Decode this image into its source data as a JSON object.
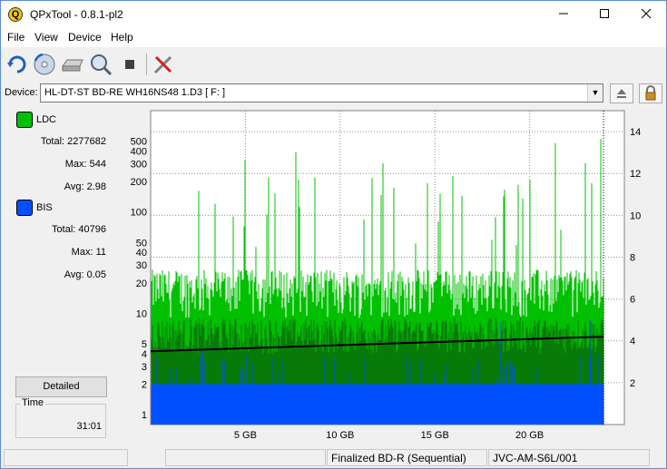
{
  "window": {
    "title": "QPxTool - 0.8.1-pl2",
    "icon_letter": "Q"
  },
  "menu": {
    "items": [
      "File",
      "View",
      "Device",
      "Help"
    ]
  },
  "toolbar": {
    "icons": [
      "refresh-icon",
      "disc-icon",
      "drive-icon",
      "zoom-icon",
      "stop-icon",
      "tools-icon"
    ]
  },
  "device": {
    "label": "Device:",
    "selected": "HL-DT-ST BD-RE  WH16NS48  1.D3 [ F: ]"
  },
  "legend": {
    "ldc": {
      "name": "LDC",
      "color": "#00c000",
      "total_label": "Total:",
      "total": "2277682",
      "max_label": "Max:",
      "max": "544",
      "avg_label": "Avg:",
      "avg": "2.98"
    },
    "bis": {
      "name": "BIS",
      "color": "#0050ff",
      "total_label": "Total:",
      "total": "40796",
      "max_label": "Max:",
      "max": "11",
      "avg_label": "Avg:",
      "avg": "0.05"
    }
  },
  "detailed_button": "Detailed",
  "time": {
    "label": "Time",
    "value": "31:01"
  },
  "status": {
    "disc_type": "Finalized BD-R (Sequential)",
    "media_id": "JVC-AM-S6L/001"
  },
  "chart_data": {
    "type": "area",
    "x_ticks": [
      "5 GB",
      "10 GB",
      "15 GB",
      "20 GB"
    ],
    "x_tick_values": [
      5,
      10,
      15,
      20
    ],
    "xlim": [
      0,
      25
    ],
    "data_end_x": 23.9,
    "y_left_scale": "log",
    "y_left_ticks": [
      "1",
      "2",
      "3",
      "4",
      "5",
      "10",
      "20",
      "30",
      "40",
      "50",
      "100",
      "200",
      "300",
      "400",
      "500"
    ],
    "y_left_values": [
      1,
      2,
      3,
      4,
      5,
      10,
      20,
      30,
      40,
      50,
      100,
      200,
      300,
      400,
      500
    ],
    "y_left_range": [
      0.8,
      1000
    ],
    "y_right_ticks": [
      "2",
      "4",
      "6",
      "8",
      "10",
      "12",
      "14"
    ],
    "y_right_values": [
      2,
      4,
      6,
      8,
      10,
      12,
      14
    ],
    "y_right_range": [
      0,
      15
    ],
    "grid": true,
    "series": [
      {
        "name": "LDC",
        "color": "#00c000",
        "typical_level": 15,
        "peak_max": 544
      },
      {
        "name": "BIS",
        "color": "#0050ff",
        "typical_level": 2,
        "peak_max": 11
      }
    ],
    "speed_line": {
      "color": "#000000",
      "start": 3.5,
      "end": 4.2
    }
  }
}
